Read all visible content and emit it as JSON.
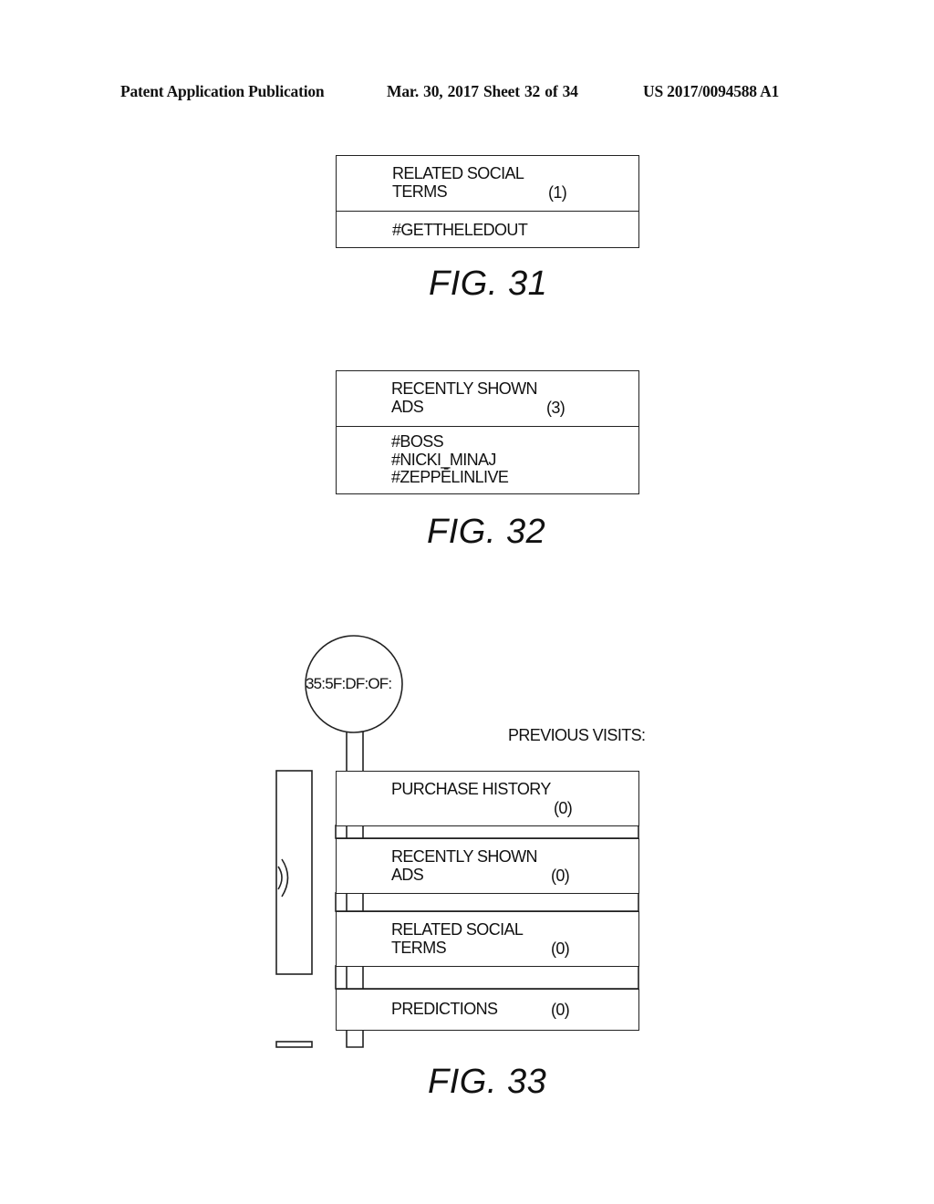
{
  "header": {
    "publication_type": "Patent Application Publication",
    "date_sheet": "Mar. 30, 2017  Sheet 32 of 34",
    "publication_number": "US 2017/0094588 A1"
  },
  "fig31": {
    "label": "FIG. 31",
    "title_line1": "RELATED SOCIAL",
    "title_line2": "TERMS",
    "count": "(1)",
    "items": [
      "#GETTHELEDOUT"
    ]
  },
  "fig32": {
    "label": "FIG. 32",
    "title_line1": "RECENTLY SHOWN",
    "title_line2": "ADS",
    "count": "(3)",
    "items": [
      "#BOSS",
      "#NICKI_MINAJ",
      "#ZEPPĒLINLIVE"
    ]
  },
  "fig33": {
    "label": "FIG. 33",
    "device_id": "35:5F:DF:OF:",
    "previous_visits_label": "PREVIOUS VISITS:",
    "icons": {
      "beacon": "wireless-signal-icon"
    },
    "panels": [
      {
        "title_line1": "PURCHASE HISTORY",
        "title_line2": "",
        "count": "(0)"
      },
      {
        "title_line1": "RECENTLY SHOWN",
        "title_line2": "ADS",
        "count": "(0)"
      },
      {
        "title_line1": "RELATED SOCIAL",
        "title_line2": "TERMS",
        "count": "(0)"
      },
      {
        "title_line1": "PREDICTIONS",
        "title_line2": "",
        "count": "(0)"
      }
    ]
  }
}
